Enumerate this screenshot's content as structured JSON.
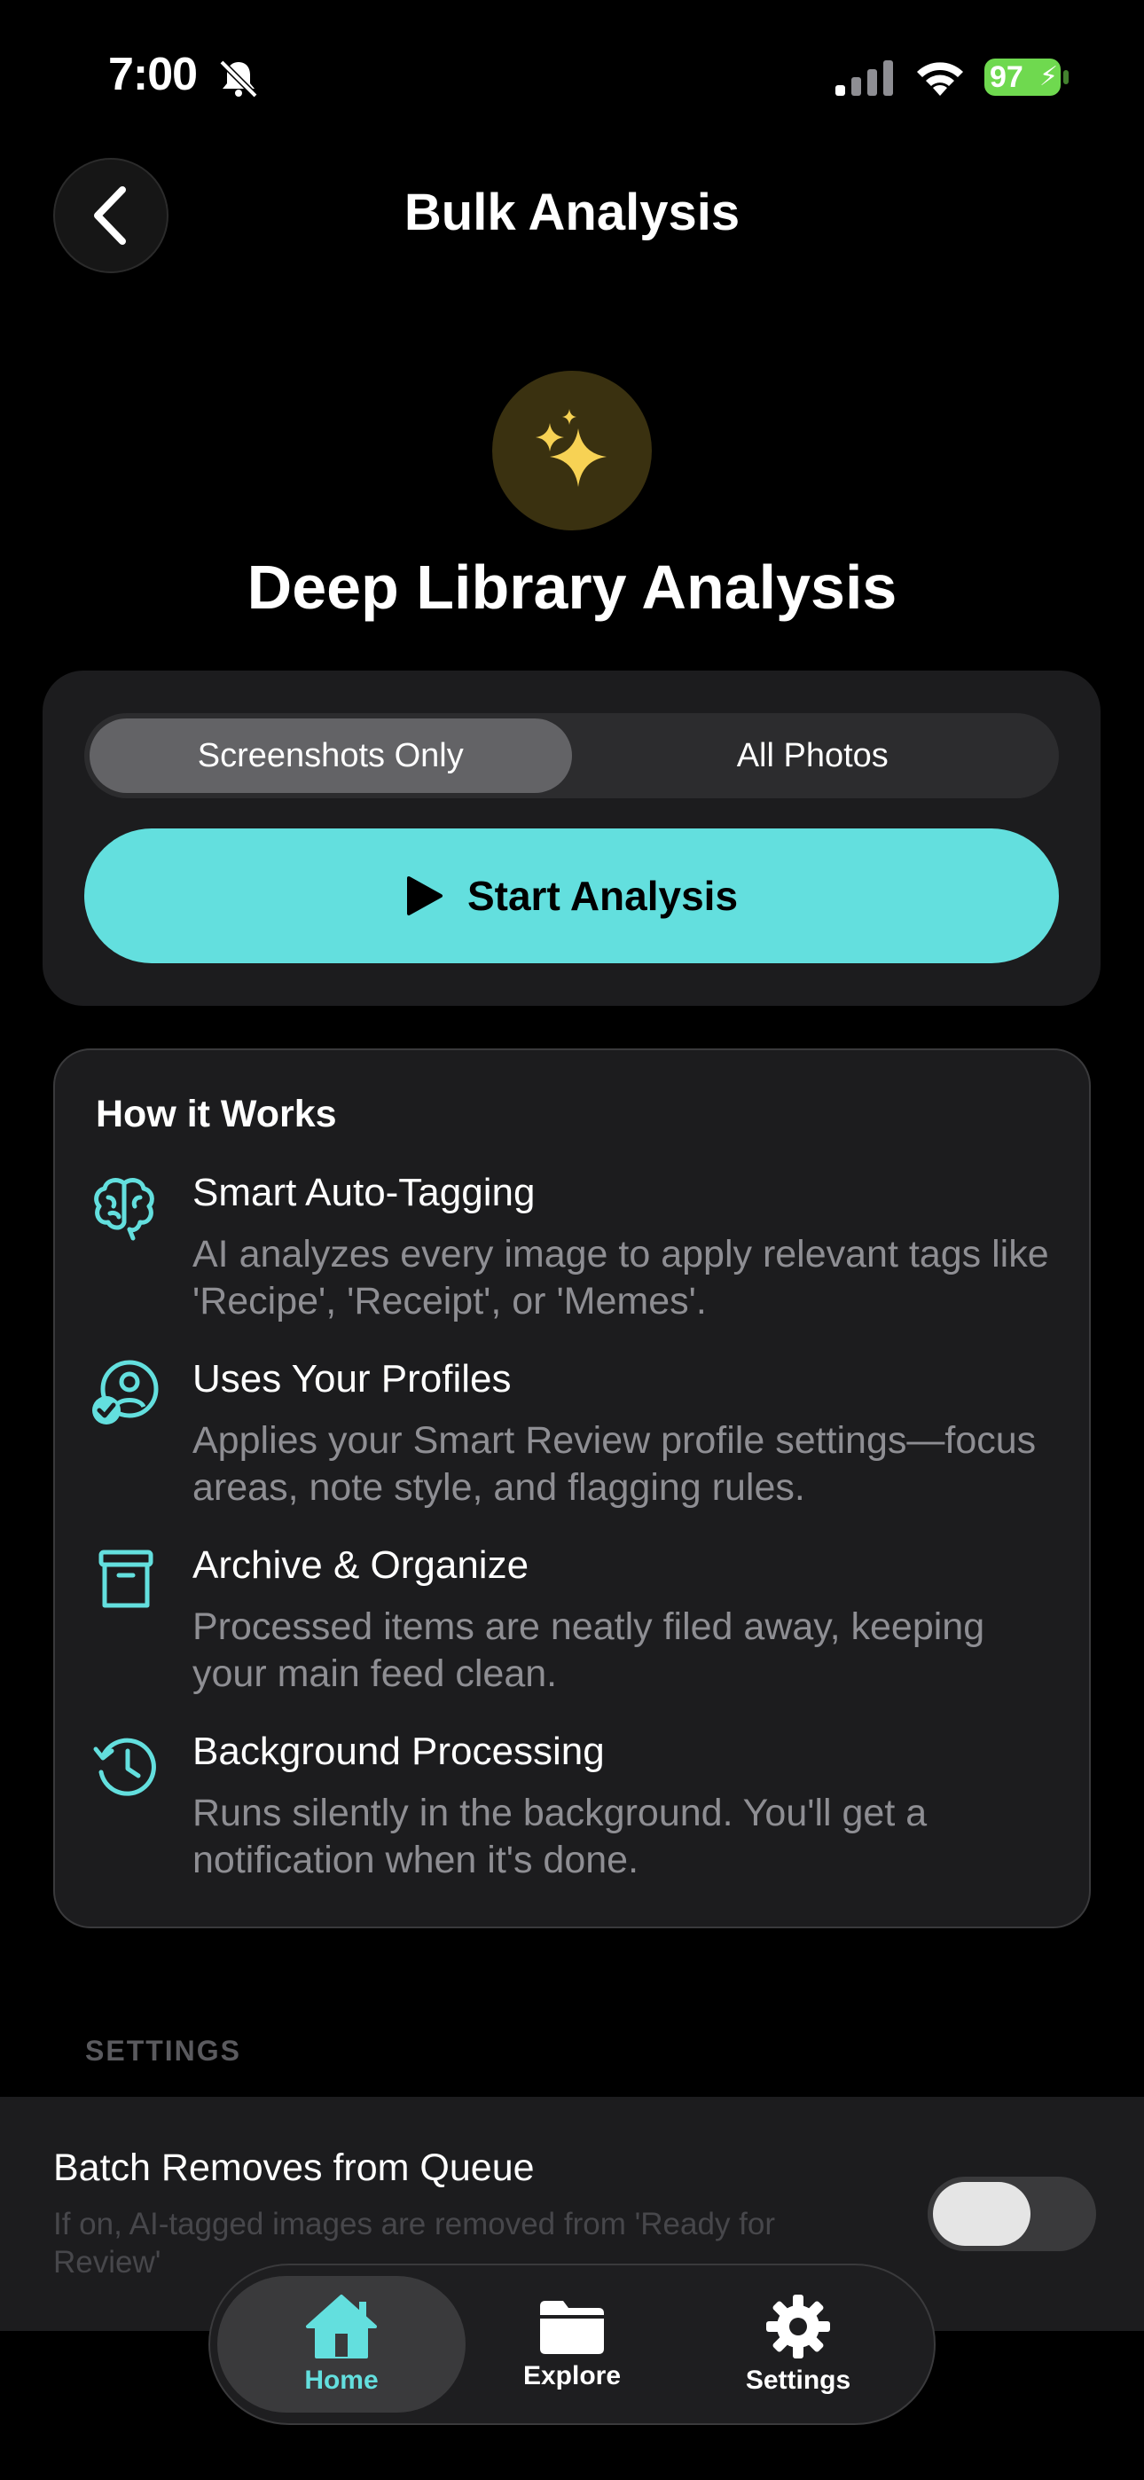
{
  "status_bar": {
    "time": "7:00",
    "battery": "97"
  },
  "header": {
    "title": "Bulk Analysis"
  },
  "hero": {
    "title": "Deep Library Analysis"
  },
  "scope": {
    "options": [
      "Screenshots Only",
      "All Photos"
    ],
    "selected": "Screenshots Only"
  },
  "start_button": {
    "label": "Start Analysis"
  },
  "how_it_works": {
    "title": "How it Works",
    "items": [
      {
        "icon": "brain-icon",
        "title": "Smart Auto-Tagging",
        "description": "AI analyzes every image to apply relevant tags like 'Recipe', 'Receipt', or 'Memes'."
      },
      {
        "icon": "profile-check-icon",
        "title": "Uses Your Profiles",
        "description": "Applies your Smart Review profile settings—focus areas, note style, and flagging rules."
      },
      {
        "icon": "archive-box-icon",
        "title": "Archive & Organize",
        "description": "Processed items are neatly filed away, keeping your main feed clean."
      },
      {
        "icon": "history-clock-icon",
        "title": "Background Processing",
        "description": "Runs silently in the background. You'll get a notification when it's done."
      }
    ]
  },
  "settings": {
    "header": "SETTINGS",
    "batch_remove": {
      "title": "Batch Removes from Queue",
      "description": "If on, AI-tagged images are removed from 'Ready for Review'",
      "enabled": false
    }
  },
  "tabbar": {
    "items": [
      {
        "label": "Home",
        "icon": "house-icon",
        "active": true
      },
      {
        "label": "Explore",
        "icon": "folder-icon",
        "active": false
      },
      {
        "label": "Settings",
        "icon": "gear-icon",
        "active": false
      }
    ]
  },
  "colors": {
    "accent": "#63dfde",
    "hero_icon_bg": "#3a3110",
    "sparkle": "#f7d254",
    "battery": "#6fd94f"
  }
}
